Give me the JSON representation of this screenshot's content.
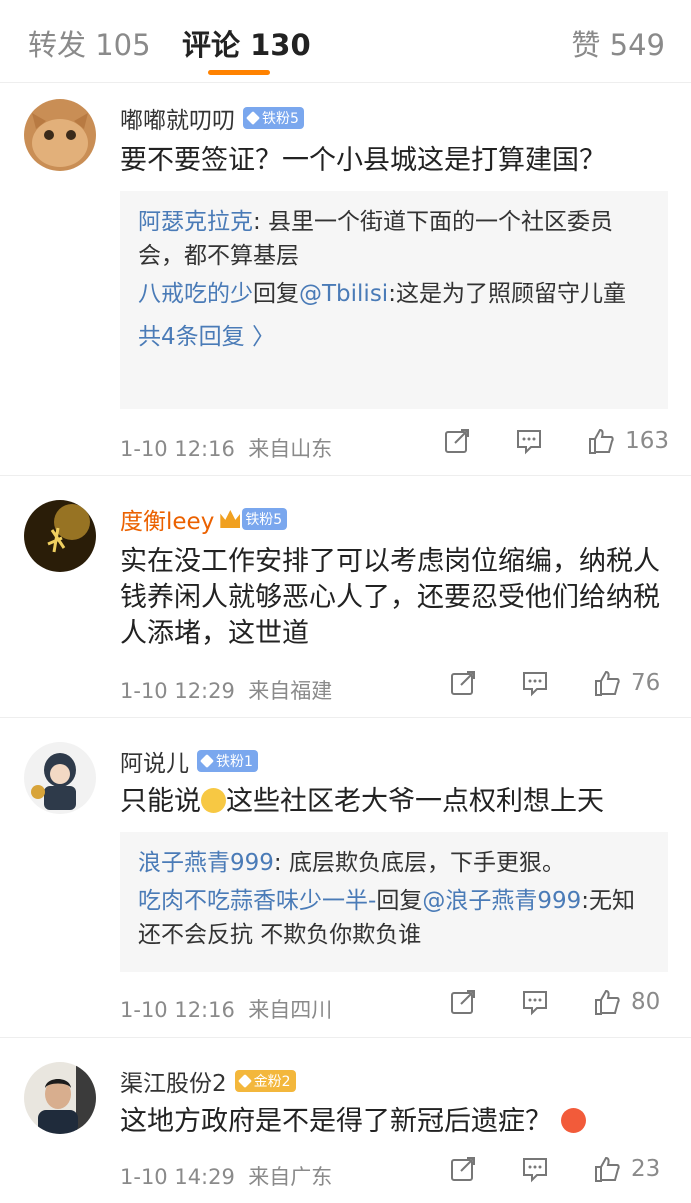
{
  "tabs": {
    "reposts": "转发 105",
    "comments": "评论 130",
    "likes": "赞 549"
  },
  "colors": {
    "accent": "#ff8200",
    "link": "#4a7bb7",
    "iron_badge": "#7aa7ee",
    "gold_badge": "#f3b73c"
  },
  "comments": [
    {
      "user": "嘟嘟就叨叨",
      "badge": "铁粉5",
      "text": "要不要签证？一个小县城这是打算建国？",
      "replies": [
        {
          "user": "阿瑟克拉克",
          "text": ": 县里一个街道下面的一个社区委员会，都不算基层"
        },
        {
          "user": "八戒吃的少",
          "mid": "回复",
          "mention": "@Tbilisi",
          "text": ":这是为了照顾留守儿童"
        }
      ],
      "more": "共4条回复 〉",
      "time": "1-10 12:16",
      "location": "来自山东",
      "likes": "163"
    },
    {
      "user": "度衡leey",
      "badge": "铁粉5",
      "text": "实在没工作安排了可以考虑岗位缩编，纳税人钱养闲人就够恶心人了，还要忍受他们给纳税人添堵，这世道",
      "time": "1-10 12:29",
      "location": "来自福建",
      "likes": "76"
    },
    {
      "user": "阿说儿",
      "badge": "铁粉1",
      "text_before": "只能说",
      "text_after": "这些社区老大爷一点权利想上天",
      "replies": [
        {
          "user": "浪子燕青999",
          "text": ": 底层欺负底层，下手更狠。"
        },
        {
          "user": "吃肉不吃蒜香味少一半-",
          "mid": "回复",
          "mention": "@浪子燕青999",
          "text": ":无知还不会反抗 不欺负你欺负谁"
        }
      ],
      "time": "1-10 12:16",
      "location": "来自四川",
      "likes": "80"
    },
    {
      "user": "渠江股份2",
      "badge": "金粉2",
      "text": "这地方政府是不是得了新冠后遗症？",
      "time": "1-10 14:29",
      "location": "来自广东",
      "likes": "23"
    }
  ],
  "icons": {
    "share": "share-icon",
    "comment": "comment-icon",
    "like": "thumbs-up-icon"
  }
}
